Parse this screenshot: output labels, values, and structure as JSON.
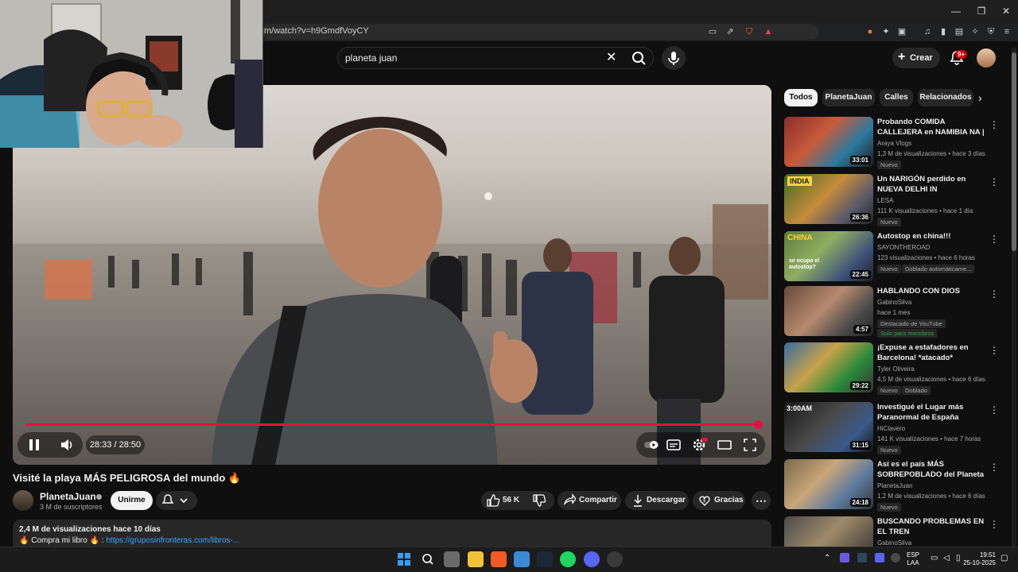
{
  "browser": {
    "url": "m/watch?v=h9GmdfVoyCY"
  },
  "header": {
    "search_value": "planeta juan",
    "create_label": "Crear",
    "notifications_badge": "9+"
  },
  "player": {
    "time": "28:33 / 28:50",
    "progress": 0.99,
    "state": "playing"
  },
  "video": {
    "title": "Visité la playa MÁS PELIGROSA del mundo 🔥",
    "channel_name": "PlanetaJuan",
    "subscribers": "3 M de suscriptores",
    "join_label": "Unirme",
    "likes": "56 K",
    "share_label": "Compartir",
    "download_label": "Descargar",
    "thanks_label": "Gracias",
    "description_stats": "2,4 M de visualizaciones  hace 10 días",
    "description_text": "🔥 Compra mi libro 🔥 : ",
    "description_link": "https://gruposinfronteras.com/libros-..."
  },
  "chips": [
    "Todos",
    "PlanetaJuan",
    "Calles",
    "Relacionados"
  ],
  "recommendations": [
    {
      "title": "Probando COMIDA CALLEJERA en NAMIBIA NA | ¡Aquí se com...",
      "channel": "Araya Vlogs",
      "stats": "1,3 M de visualizaciones • hace 3 días",
      "duration": "33:01",
      "badges": [
        "Nuevo"
      ]
    },
    {
      "title": "Un NARIGÓN perdido en NUEVA DELHI IN",
      "channel": "LESA",
      "stats": "111 K visualizaciones • hace 1 día",
      "duration": "26:36",
      "badges": [
        "Nuevo"
      ]
    },
    {
      "title": "Autostop en china!!!",
      "channel": "SAYONTHEROAD",
      "stats": "123 visualizaciones • hace 6 horas",
      "duration": "22:45",
      "badges": [
        "Nuevo",
        "Doblado automáticame..."
      ]
    },
    {
      "title": "HABLANDO CON DIOS",
      "channel": "GabinoSilva",
      "stats": "hace 1 mes",
      "duration": "4:57",
      "badges": [
        "Destacado de YouTube",
        "Solo para miembros"
      ]
    },
    {
      "title": "¡Expuse a estafadores en Barcelona! *atacado*",
      "channel": "Tyler Oliveira",
      "stats": "4,5 M de visualizaciones • hace 6 días",
      "duration": "29:22",
      "badges": [
        "Nuevo",
        "Doblado"
      ]
    },
    {
      "title": "Investigué el Lugar más Paranormal de España",
      "channel": "HiClavero",
      "stats": "141 K visualizaciones • hace 7 horas",
      "duration": "31:15",
      "badges": [
        "Nuevo"
      ]
    },
    {
      "title": "Así es el país MÁS SOBREPOBLADO del Planeta ...",
      "channel": "PlanetaJuan",
      "stats": "1,2 M de visualizaciones • hace 6 días",
      "duration": "24:18",
      "badges": [
        "Nuevo"
      ]
    },
    {
      "title": "BUSCANDO PROBLEMAS EN EL TREN",
      "channel": "GabinoSilva",
      "stats": "",
      "duration": "",
      "badges": []
    }
  ],
  "tray": {
    "lang": "ESP",
    "layout": "LAA",
    "time": "19:51",
    "date": "25-10-2025"
  },
  "thumb_texts": {
    "india": "INDIA",
    "china": "CHINA",
    "autostop": "se ocupa el autostop?",
    "time3am": "3:00AM"
  },
  "colors": {
    "accent": "#e2123e",
    "link": "#3ea6ff",
    "bg": "#0f0f0f"
  }
}
